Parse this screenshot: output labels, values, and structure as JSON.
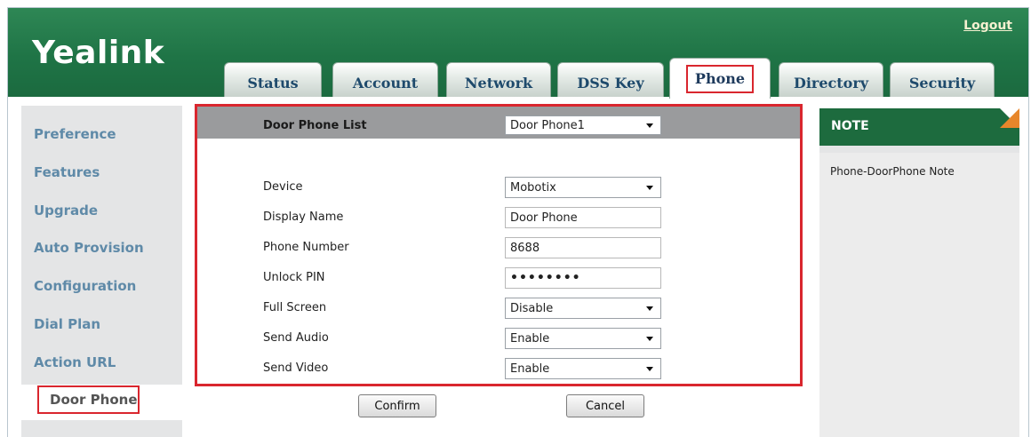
{
  "header": {
    "logo": "Yealink",
    "logout": "Logout"
  },
  "tabs": [
    {
      "label": "Status"
    },
    {
      "label": "Account"
    },
    {
      "label": "Network"
    },
    {
      "label": "DSS Key"
    },
    {
      "label": "Phone",
      "active": true
    },
    {
      "label": "Directory"
    },
    {
      "label": "Security"
    }
  ],
  "sidebar": {
    "items": [
      {
        "label": "Preference"
      },
      {
        "label": "Features"
      },
      {
        "label": "Upgrade"
      },
      {
        "label": "Auto Provision"
      },
      {
        "label": "Configuration"
      },
      {
        "label": "Dial Plan"
      },
      {
        "label": "Action URL"
      },
      {
        "label": "Door Phone",
        "active": true
      }
    ]
  },
  "form": {
    "list_label": "Door Phone List",
    "list_value": "Door Phone1",
    "fields": [
      {
        "label": "Device",
        "value": "Mobotix",
        "type": "select"
      },
      {
        "label": "Display Name",
        "value": "Door Phone",
        "type": "text"
      },
      {
        "label": "Phone Number",
        "value": "8688",
        "type": "text"
      },
      {
        "label": "Unlock PIN",
        "value": "••••••••",
        "type": "password"
      },
      {
        "label": "Full Screen",
        "value": "Disable",
        "type": "select"
      },
      {
        "label": "Send Audio",
        "value": "Enable",
        "type": "select"
      },
      {
        "label": "Send Video",
        "value": "Enable",
        "type": "select"
      }
    ]
  },
  "buttons": {
    "confirm": "Confirm",
    "cancel": "Cancel"
  },
  "note": {
    "title": "NOTE",
    "text": "Phone-DoorPhone Note"
  },
  "colors": {
    "header_green": "#1f7446",
    "highlight_red": "#d9262e",
    "nav_blue": "#5f8aa8",
    "note_accent": "#e7862b"
  }
}
